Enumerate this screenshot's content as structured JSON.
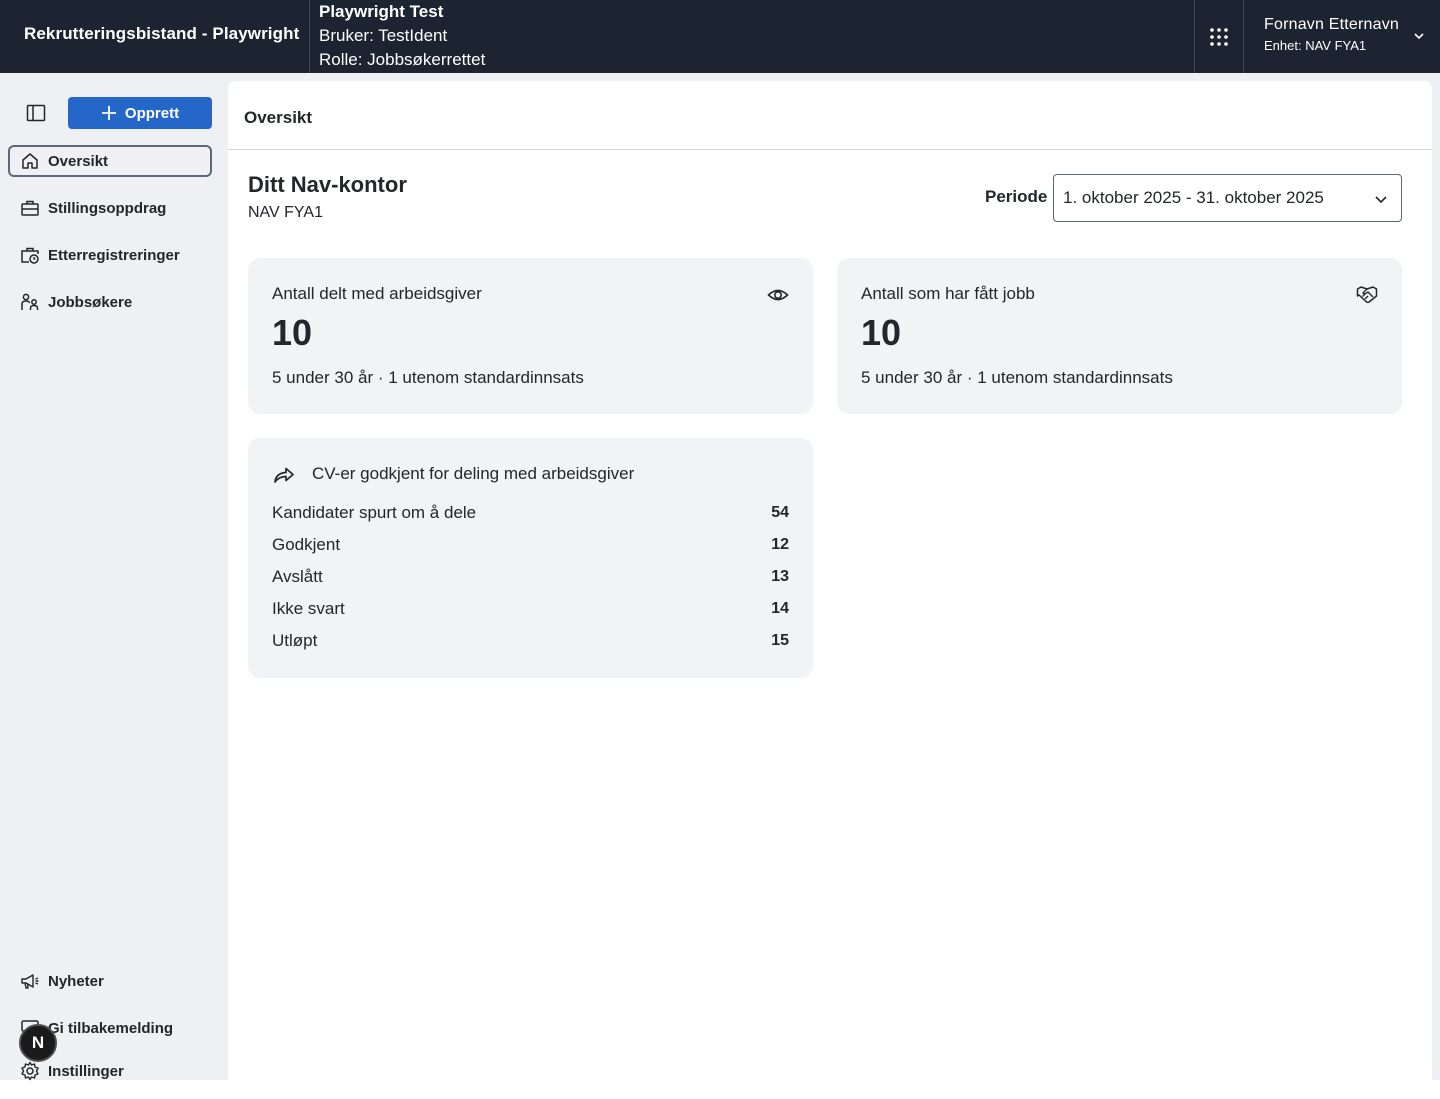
{
  "header": {
    "app_name": "Rekrutteringsbistand - Playwright",
    "env_title": "Playwright Test",
    "env_user": "Bruker: TestIdent",
    "env_role": "Rolle: Jobbsøkerrettet",
    "user_name": "Fornavn Etternavn",
    "user_unit": "Enhet: NAV FYA1"
  },
  "sidebar": {
    "create_label": "Opprett",
    "items": [
      {
        "label": "Oversikt",
        "icon": "home-icon",
        "active": true
      },
      {
        "label": "Stillingsoppdrag",
        "icon": "briefcase-icon"
      },
      {
        "label": "Etterregistreringer",
        "icon": "briefcase-clock-icon"
      },
      {
        "label": "Jobbsøkere",
        "icon": "persons-icon"
      }
    ],
    "bottom_items": [
      {
        "label": "Nyheter",
        "icon": "megaphone-icon"
      },
      {
        "label": "Gi tilbakemelding",
        "icon": "feedback-icon"
      },
      {
        "label": "Instillinger",
        "icon": "gear-icon"
      }
    ],
    "avatar_letter": "N"
  },
  "main": {
    "page_title": "Oversikt",
    "office_title": "Ditt Nav-kontor",
    "office_name": "NAV FYA1",
    "period_label": "Periode",
    "period_value": "1. oktober 2025 - 31. oktober 2025",
    "cards": [
      {
        "label": "Antall delt med arbeidsgiver",
        "value": "10",
        "detail": "5 under 30 år · 1 utenom standardinnsats",
        "icon": "eye-icon"
      },
      {
        "label": "Antall som har fått jobb",
        "value": "10",
        "detail": "5 under 30 år · 1 utenom standardinnsats",
        "icon": "handshake-icon"
      }
    ],
    "cv_card": {
      "title": "CV-er godkjent for deling med arbeidsgiver",
      "icon": "share-arrow-icon",
      "rows": [
        {
          "label": "Kandidater spurt om å dele",
          "value": "54"
        },
        {
          "label": "Godkjent",
          "value": "12"
        },
        {
          "label": "Avslått",
          "value": "13"
        },
        {
          "label": "Ikke svart",
          "value": "14"
        },
        {
          "label": "Utløpt",
          "value": "15"
        }
      ]
    }
  }
}
